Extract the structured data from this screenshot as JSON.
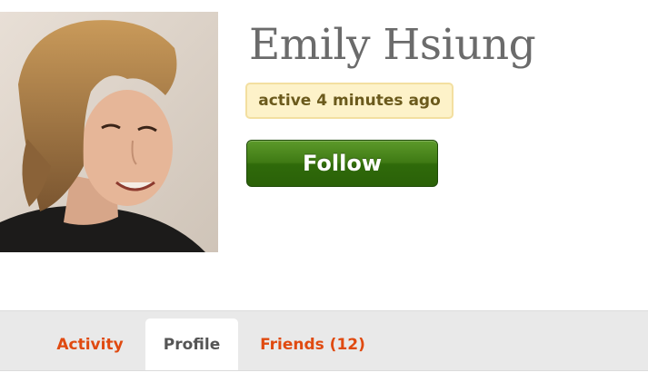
{
  "profile": {
    "name": "Emily Hsiung",
    "status": "active 4 minutes ago",
    "follow_label": "Follow"
  },
  "tabs": [
    {
      "label": "Activity",
      "active": false
    },
    {
      "label": "Profile",
      "active": true
    },
    {
      "label": "Friends (12)",
      "active": false
    }
  ],
  "colors": {
    "name_text": "#6b6b6b",
    "status_bg": "#fdf2c9",
    "status_text": "#6b5a1c",
    "follow_button": "#3f7a14",
    "tab_link": "#e04a10",
    "tab_active_text": "#555555",
    "tab_bar_bg": "#e9e9e9"
  }
}
